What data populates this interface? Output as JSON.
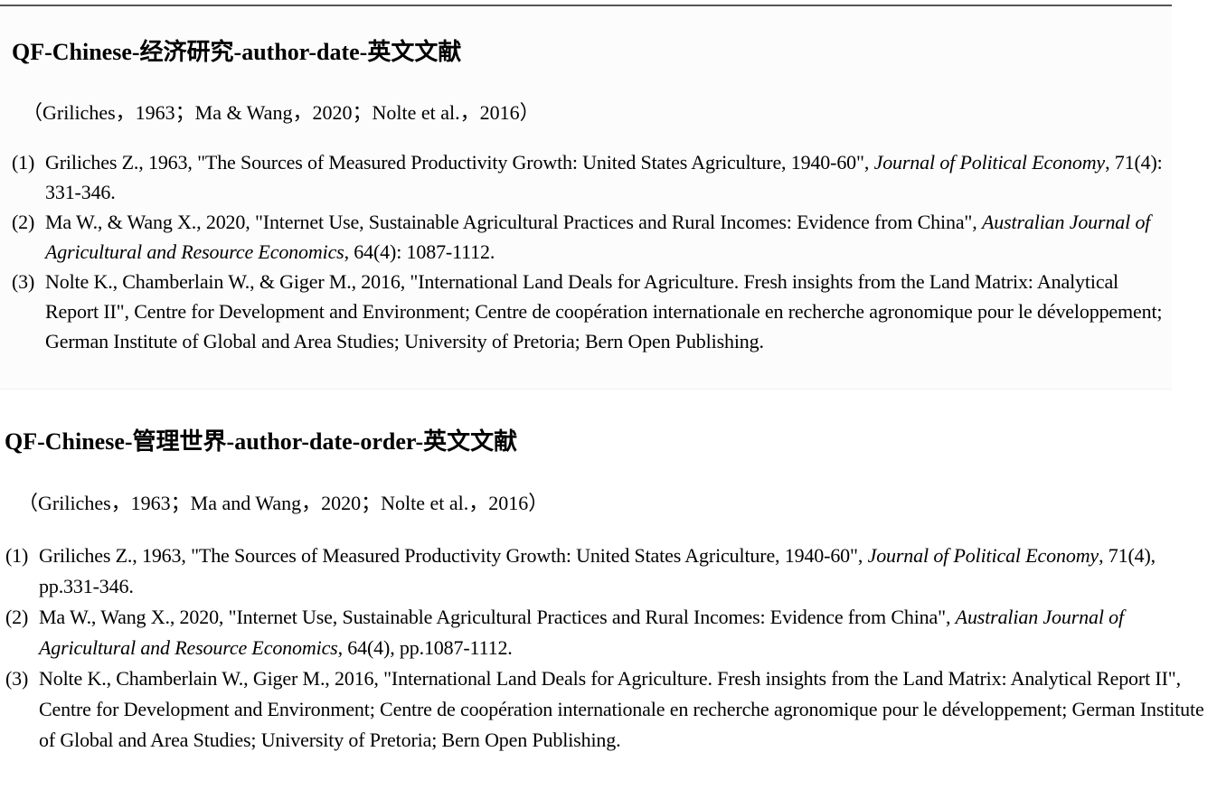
{
  "section1": {
    "heading": "QF-Chinese-经济研究-author-date-英文文献",
    "citation": "（Griliches，1963；Ma & Wang，2020；Nolte et al.，2016）",
    "references": [
      {
        "num": "(1)",
        "pre": "Griliches Z., 1963, \"The Sources of Measured Productivity Growth: United States Agriculture, 1940-60\", ",
        "journal": "Journal of Political Economy",
        "post": ", 71(4): 331-346."
      },
      {
        "num": "(2)",
        "pre": "Ma W., & Wang X., 2020, \"Internet Use, Sustainable Agricultural Practices and Rural Incomes: Evidence from China\", ",
        "journal": "Australian Journal of Agricultural and Resource Economics",
        "post": ", 64(4): 1087-1112."
      },
      {
        "num": "(3)",
        "pre": "Nolte K., Chamberlain W., & Giger M., 2016, \"International Land Deals for Agriculture. Fresh insights from the Land Matrix: Analytical Report II\", Centre for Development and Environment; Centre de coopération internationale en recherche agronomique pour le développement; German Institute of Global and Area Studies; University of Pretoria; Bern Open Publishing.",
        "journal": "",
        "post": ""
      }
    ]
  },
  "section2": {
    "heading": "QF-Chinese-管理世界-author-date-order-英文文献",
    "citation": "（Griliches，1963；Ma and Wang，2020；Nolte et al.，2016）",
    "references": [
      {
        "num": "(1)",
        "pre": "Griliches Z., 1963, \"The Sources of Measured Productivity Growth: United States Agriculture, 1940-60\", ",
        "journal": "Journal of Political Economy",
        "post": ", 71(4), pp.331-346."
      },
      {
        "num": "(2)",
        "pre": "Ma W., Wang X., 2020, \"Internet Use, Sustainable Agricultural Practices and Rural Incomes: Evidence from China\", ",
        "journal": "Australian Journal of Agricultural and Resource Economics",
        "post": ", 64(4), pp.1087-1112."
      },
      {
        "num": "(3)",
        "pre": "Nolte K., Chamberlain W., Giger M., 2016, \"International Land Deals for Agriculture. Fresh insights from the Land Matrix: Analytical Report II\", Centre for Development and Environment; Centre de coopération internationale en recherche agronomique pour le développement; German Institute of Global and Area Studies; University of Pretoria; Bern Open Publishing.",
        "journal": "",
        "post": ""
      }
    ]
  }
}
